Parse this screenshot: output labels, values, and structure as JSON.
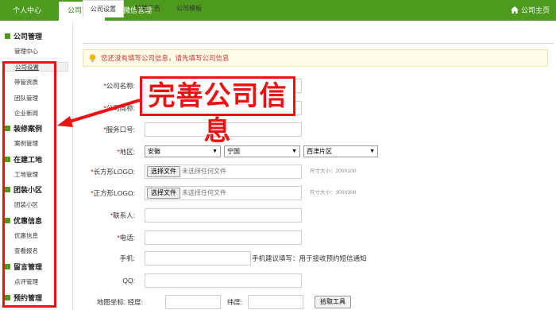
{
  "topnav": {
    "items": [
      {
        "label": "个人中心",
        "active": false
      },
      {
        "label": "公司管理",
        "active": true
      },
      {
        "label": "微信管理",
        "active": false
      }
    ],
    "home_label": "公司主页"
  },
  "sidebar": {
    "sections": [
      {
        "title": "公司管理",
        "items": [
          "管理中心",
          "公司设置",
          "带管资质",
          "团队管理",
          "企业新闻"
        ]
      },
      {
        "title": "装修案例",
        "items": [
          "案例管理"
        ]
      },
      {
        "title": "在建工地",
        "items": [
          "工地管理"
        ]
      },
      {
        "title": "团装小区",
        "items": [
          "团装小区"
        ]
      },
      {
        "title": "优惠信息",
        "items": [
          "优惠信息",
          "查看报名"
        ]
      },
      {
        "title": "留言管理",
        "items": [
          "点评管理"
        ]
      },
      {
        "title": "预约管理",
        "items": []
      }
    ],
    "selected_item": "公司设置"
  },
  "tabs": [
    "公司设置",
    "轮转广告",
    "公司模板"
  ],
  "notice": "您还没有填写公司信息，请先填写公司信息",
  "annotation": "完善公司信息",
  "form": {
    "company_name_label": "公司名称:",
    "company_short_label": "公司简称:",
    "service_phone_label": "服务口号:",
    "region_label": "地区:",
    "region_province": "安徽",
    "region_city": "宁国",
    "region_district": "西津片区",
    "logo_rect_label": "长方形LOGO:",
    "logo_square_label": "正方形LOGO:",
    "file_button": "选择文件",
    "file_none": "未选择任何文件",
    "size_rect": "尺寸大小：200X100",
    "size_square": "尺寸大小：300X300",
    "contact_label": "联系人:",
    "tel_label": "电话:",
    "mobile_label": "手机:",
    "mobile_tip": "手机建议填写：用于接收预约短信通知",
    "qq_label": "QQ:",
    "map_label": "地图坐标:",
    "lng_label": "经度:",
    "lat_label": "纬度:",
    "pick_button": "拾取工具"
  },
  "colors": {
    "brand": "#4d9a1e",
    "highlight": "#ee1111",
    "notice_bg": "#fefce9"
  }
}
